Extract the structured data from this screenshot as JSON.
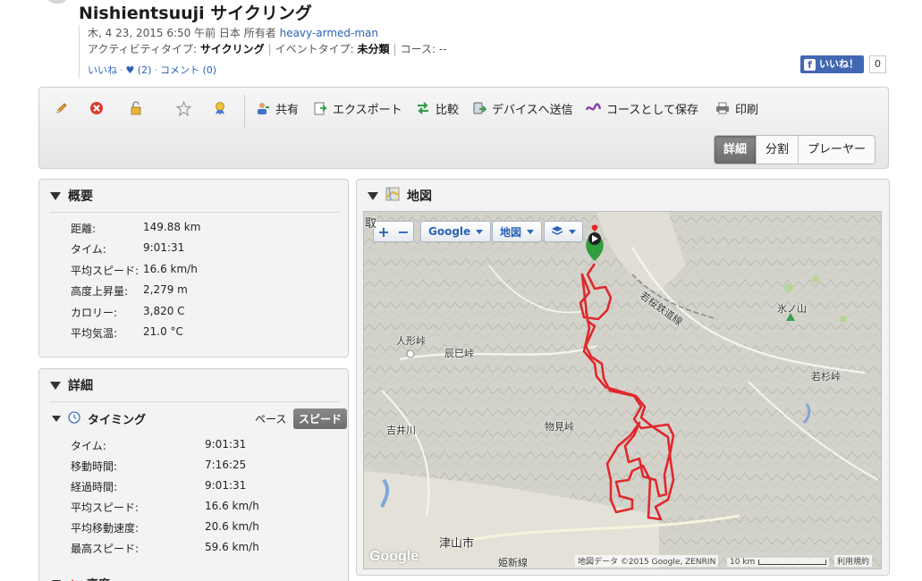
{
  "activity": {
    "title": "Nishientsuuji サイクリング",
    "date": "木, 4 23, 2015 6:50 午前 日本",
    "owner_label": "所有者",
    "owner": "heavy-armed-man",
    "activity_type_label": "アクティビティタイプ:",
    "activity_type": "サイクリング",
    "event_type_label": "イベントタイプ:",
    "event_type": "未分類",
    "course_label": "コース:",
    "course": "--",
    "like_label": "いいね",
    "hearts": "♥ (2)",
    "comment_label": "コメント (0)"
  },
  "facebook": {
    "like_label": "いいね！",
    "count": "0"
  },
  "toolbar": {
    "icons": [
      "pencil-icon",
      "delete-icon",
      "lock-icon",
      "star-icon",
      "award-icon"
    ],
    "share": "共有",
    "export": "エクスポート",
    "compare": "比較",
    "send_to_device": "デバイスへ送信",
    "save_as_course": "コースとして保存",
    "print": "印刷",
    "views": [
      "詳細",
      "分割",
      "プレーヤー"
    ],
    "active_view": "詳細"
  },
  "summary": {
    "title": "概要",
    "rows": [
      {
        "label": "距離:",
        "value": "149.88 km"
      },
      {
        "label": "タイム:",
        "value": "9:01:31"
      },
      {
        "label": "平均スピード:",
        "value": "16.6 km/h"
      },
      {
        "label": "高度上昇量:",
        "value": "2,279 m"
      },
      {
        "label": "カロリー:",
        "value": "3,820 C"
      },
      {
        "label": "平均気温:",
        "value": "21.0 °C"
      }
    ]
  },
  "details": {
    "title": "詳細",
    "timing_title": "タイミング",
    "pace_label": "ペース",
    "speed_label": "スピード",
    "rows": [
      {
        "label": "タイム:",
        "value": "9:01:31"
      },
      {
        "label": "移動時間:",
        "value": "7:16:25"
      },
      {
        "label": "経過時間:",
        "value": "9:01:31"
      },
      {
        "label": "平均スピード:",
        "value": "16.6 km/h"
      },
      {
        "label": "平均移動速度:",
        "value": "20.6 km/h"
      },
      {
        "label": "最高スピード:",
        "value": "59.6 km/h"
      }
    ],
    "next_section": "高度"
  },
  "map": {
    "title": "地図",
    "zoom_in": "+",
    "zoom_out": "−",
    "provider": "Google",
    "map_type": "地図",
    "labels": {
      "railway": "若桜鉄道線",
      "hyonosen": "氷ノ山",
      "ningyo": "人形峠",
      "tatsumi": "辰巳峠",
      "yoshii": "吉井川",
      "kurami": "物見峠",
      "wakasa": "若杉峠",
      "tsuyama": "津山市",
      "tottori_prefix": "取",
      "bottom_partial": "姫新線"
    },
    "attribution": "地図データ ©2015 Google, ZENRIN",
    "scale": "10 km",
    "terms": "利用規約",
    "google_logo": "Google"
  }
}
